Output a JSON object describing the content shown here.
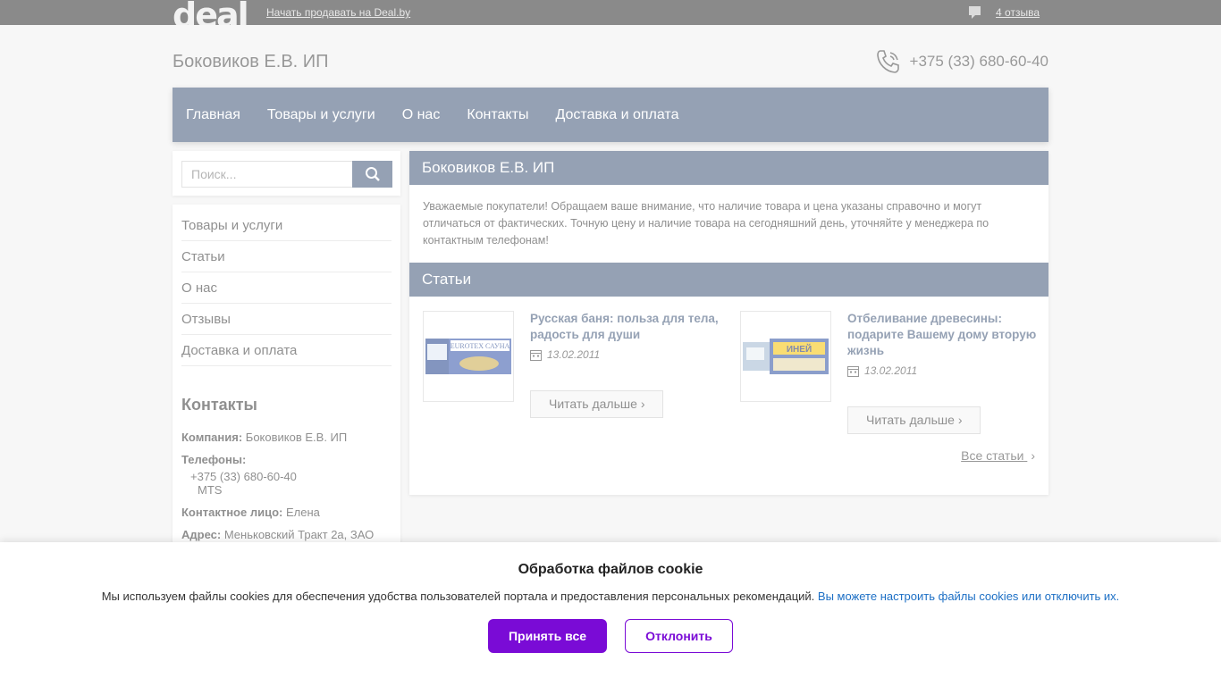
{
  "topbar": {
    "logo": "deal",
    "start_selling": "Начать продавать на Deal.by",
    "reviews": "4 отзыва"
  },
  "header": {
    "company": "Боковиков Е.В. ИП",
    "phone": "+375 (33) 680-60-40"
  },
  "nav": {
    "items": [
      "Главная",
      "Товары и услуги",
      "О нас",
      "Контакты",
      "Доставка и оплата"
    ]
  },
  "search": {
    "placeholder": "Поиск..."
  },
  "sidebar": {
    "items": [
      "Товары и услуги",
      "Статьи",
      "О нас",
      "Отзывы",
      "Доставка и оплата"
    ],
    "contacts_title": "Контакты",
    "company_label": "Компания:",
    "company_value": "Боковиков Е.В. ИП",
    "phones_label": "Телефоны:",
    "phone_value": "+375 (33) 680-60-40",
    "operator": "MTS",
    "person_label": "Контактное лицо:",
    "person_value": "Елена",
    "address_label": "Адрес:",
    "address_value": "Меньковский Тракт 2а, ЗАО"
  },
  "main": {
    "panel_title": "Боковиков Е.В. ИП",
    "notice": "Уважаемые покупатели! Обращаем ваше внимание, что наличие товара и цена указаны справочно и могут отличаться от фактических. Точную цену и наличие товара на сегодняшний день, уточняйте у менеджера по контактным телефонам!",
    "articles_title": "Статьи",
    "articles": [
      {
        "title": "Русская баня: польза для тела, радость для души",
        "date": "13.02.2011",
        "read_more": "Читать дальше",
        "thumb_text": "EUROTEX САУНА"
      },
      {
        "title": "Отбеливание древесины: подарите Вашему дому вторую жизнь",
        "date": "13.02.2011",
        "read_more": "Читать дальше",
        "thumb_text": "ИНЕЙ"
      }
    ],
    "all_articles": "Все статьи"
  },
  "cookie": {
    "title": "Обработка файлов cookie",
    "text": "Мы используем файлы cookies для обеспечения удобства пользователей портала и предоставления персональных рекомендаций.",
    "link": "Вы можете настроить файлы cookies или отключить их.",
    "accept": "Принять все",
    "decline": "Отклонить"
  },
  "colors": {
    "nav": "#3e5577",
    "accent_purple": "#7a0bd6",
    "link_blue": "#1c6fc5"
  }
}
